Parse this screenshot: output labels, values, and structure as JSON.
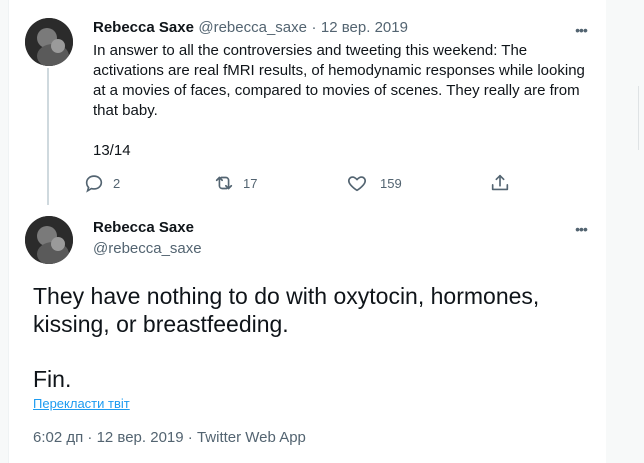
{
  "tweet1": {
    "name": "Rebecca Saxe",
    "handle": "@rebecca_saxe",
    "sep": "·",
    "date": "12 вер. 2019",
    "text": "In answer to all the controversies and tweeting this weekend: The activations are real fMRI results, of hemodynamic responses while looking at a movies of faces, compared to movies of scenes. They really are from that baby.",
    "thread_count": "13/14",
    "more": "•••",
    "actions": {
      "replies": "2",
      "retweets": "17",
      "likes": "159"
    }
  },
  "tweet2": {
    "name": "Rebecca Saxe",
    "handle": "@rebecca_saxe",
    "more": "•••",
    "body": "They have nothing to do with oxytocin, hormones, kissing, or breastfeeding.",
    "fin": "Fin.",
    "translate": "Перекласти твіт",
    "meta": "6:02 дп · 12 вер. 2019 · Twitter Web App"
  },
  "colors": {
    "accent": "#1d9bf0",
    "muted": "#536471",
    "text": "#0f1419"
  },
  "icons": [
    "reply-icon",
    "retweet-icon",
    "like-icon",
    "share-icon",
    "more-icon"
  ]
}
